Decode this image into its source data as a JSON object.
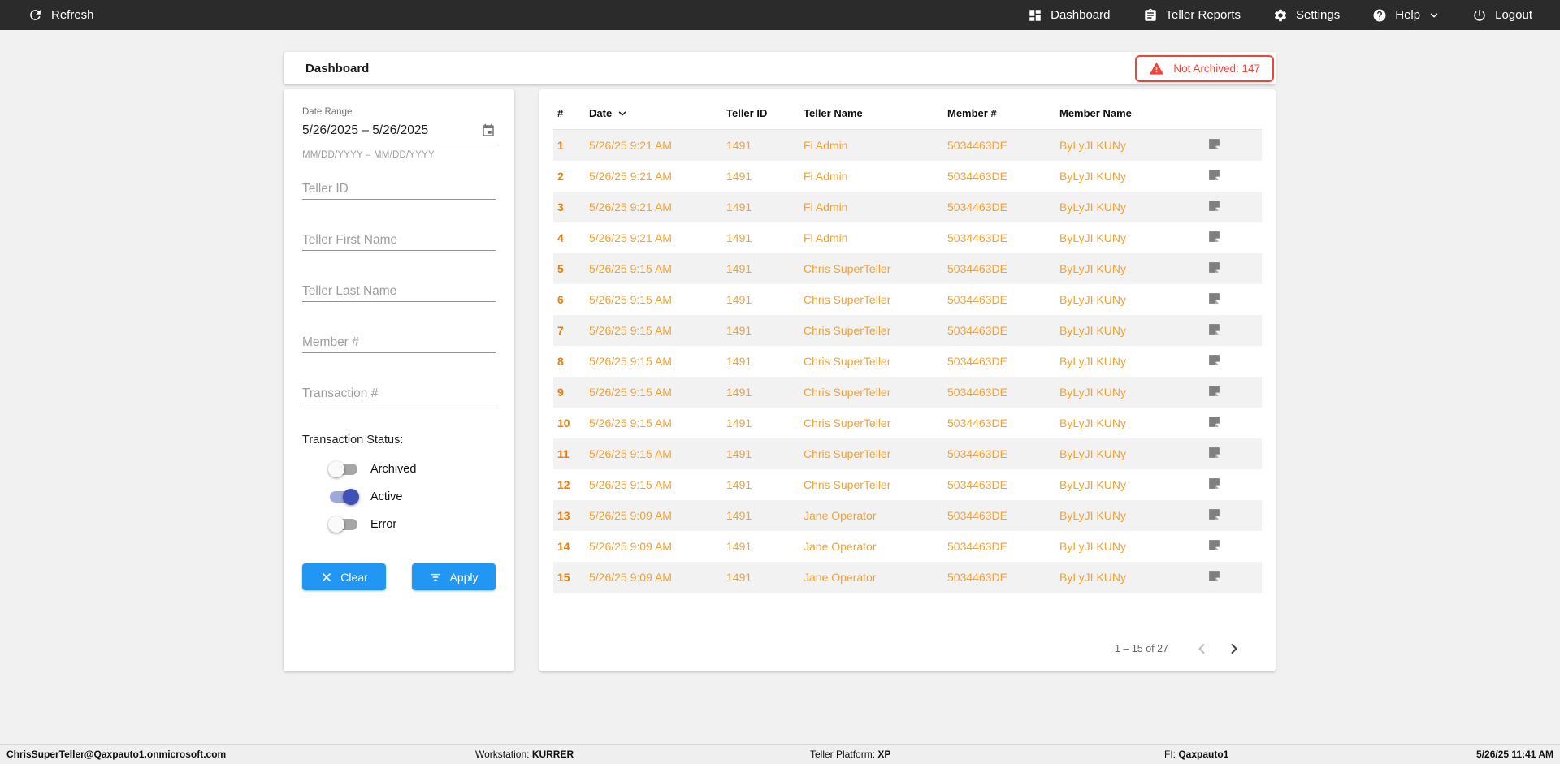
{
  "topnav": {
    "refresh_label": "Refresh",
    "items": [
      {
        "id": "dashboard",
        "label": "Dashboard",
        "icon": "dashboard-icon"
      },
      {
        "id": "teller-reports",
        "label": "Teller Reports",
        "icon": "clipboard-icon"
      },
      {
        "id": "settings",
        "label": "Settings",
        "icon": "gear-icon"
      },
      {
        "id": "help",
        "label": "Help",
        "icon": "help-icon",
        "has_chevron": true
      },
      {
        "id": "logout",
        "label": "Logout",
        "icon": "power-icon"
      }
    ]
  },
  "header": {
    "title": "Dashboard",
    "badge": {
      "label": "Not Archived: 147",
      "icon": "warning-icon",
      "color": "#f44336"
    }
  },
  "filters": {
    "date_range": {
      "label": "Date Range",
      "value": "5/26/2025 – 5/26/2025",
      "hint": "MM/DD/YYYY – MM/DD/YYYY",
      "icon": "calendar-icon"
    },
    "inputs": [
      {
        "id": "teller-id",
        "placeholder": "Teller ID",
        "value": ""
      },
      {
        "id": "teller-first-name",
        "placeholder": "Teller First Name",
        "value": ""
      },
      {
        "id": "teller-last-name",
        "placeholder": "Teller Last Name",
        "value": ""
      },
      {
        "id": "member-number",
        "placeholder": "Member #",
        "value": ""
      },
      {
        "id": "transaction-number",
        "placeholder": "Transaction #",
        "value": ""
      }
    ],
    "status": {
      "label": "Transaction Status:",
      "toggles": [
        {
          "id": "archived",
          "label": "Archived",
          "on": false
        },
        {
          "id": "active",
          "label": "Active",
          "on": true
        },
        {
          "id": "error",
          "label": "Error",
          "on": false
        }
      ]
    },
    "clear_label": "Clear",
    "apply_label": "Apply"
  },
  "table": {
    "columns": [
      {
        "id": "row-number",
        "label": "#"
      },
      {
        "id": "date",
        "label": "Date",
        "sorted": "desc"
      },
      {
        "id": "teller-id",
        "label": "Teller ID"
      },
      {
        "id": "teller-name",
        "label": "Teller Name"
      },
      {
        "id": "member-number",
        "label": "Member #"
      },
      {
        "id": "member-name",
        "label": "Member Name"
      },
      {
        "id": "note",
        "label": ""
      }
    ],
    "rows": [
      {
        "num": "1",
        "date": "5/26/25 9:21 AM",
        "teller_id": "1491",
        "teller_name": "Fi Admin",
        "member_number": "5034463DE",
        "member_name": "ByLyJI KUNy"
      },
      {
        "num": "2",
        "date": "5/26/25 9:21 AM",
        "teller_id": "1491",
        "teller_name": "Fi Admin",
        "member_number": "5034463DE",
        "member_name": "ByLyJI KUNy"
      },
      {
        "num": "3",
        "date": "5/26/25 9:21 AM",
        "teller_id": "1491",
        "teller_name": "Fi Admin",
        "member_number": "5034463DE",
        "member_name": "ByLyJI KUNy"
      },
      {
        "num": "4",
        "date": "5/26/25 9:21 AM",
        "teller_id": "1491",
        "teller_name": "Fi Admin",
        "member_number": "5034463DE",
        "member_name": "ByLyJI KUNy"
      },
      {
        "num": "5",
        "date": "5/26/25 9:15 AM",
        "teller_id": "1491",
        "teller_name": "Chris SuperTeller",
        "member_number": "5034463DE",
        "member_name": "ByLyJI KUNy"
      },
      {
        "num": "6",
        "date": "5/26/25 9:15 AM",
        "teller_id": "1491",
        "teller_name": "Chris SuperTeller",
        "member_number": "5034463DE",
        "member_name": "ByLyJI KUNy"
      },
      {
        "num": "7",
        "date": "5/26/25 9:15 AM",
        "teller_id": "1491",
        "teller_name": "Chris SuperTeller",
        "member_number": "5034463DE",
        "member_name": "ByLyJI KUNy"
      },
      {
        "num": "8",
        "date": "5/26/25 9:15 AM",
        "teller_id": "1491",
        "teller_name": "Chris SuperTeller",
        "member_number": "5034463DE",
        "member_name": "ByLyJI KUNy"
      },
      {
        "num": "9",
        "date": "5/26/25 9:15 AM",
        "teller_id": "1491",
        "teller_name": "Chris SuperTeller",
        "member_number": "5034463DE",
        "member_name": "ByLyJI KUNy"
      },
      {
        "num": "10",
        "date": "5/26/25 9:15 AM",
        "teller_id": "1491",
        "teller_name": "Chris SuperTeller",
        "member_number": "5034463DE",
        "member_name": "ByLyJI KUNy"
      },
      {
        "num": "11",
        "date": "5/26/25 9:15 AM",
        "teller_id": "1491",
        "teller_name": "Chris SuperTeller",
        "member_number": "5034463DE",
        "member_name": "ByLyJI KUNy"
      },
      {
        "num": "12",
        "date": "5/26/25 9:15 AM",
        "teller_id": "1491",
        "teller_name": "Chris SuperTeller",
        "member_number": "5034463DE",
        "member_name": "ByLyJI KUNy"
      },
      {
        "num": "13",
        "date": "5/26/25 9:09 AM",
        "teller_id": "1491",
        "teller_name": "Jane Operator",
        "member_number": "5034463DE",
        "member_name": "ByLyJI KUNy"
      },
      {
        "num": "14",
        "date": "5/26/25 9:09 AM",
        "teller_id": "1491",
        "teller_name": "Jane Operator",
        "member_number": "5034463DE",
        "member_name": "ByLyJI KUNy"
      },
      {
        "num": "15",
        "date": "5/26/25 9:09 AM",
        "teller_id": "1491",
        "teller_name": "Jane Operator",
        "member_number": "5034463DE",
        "member_name": "ByLyJI KUNy"
      }
    ],
    "row_note_icon": "note-icon",
    "pagination": {
      "label": "1 – 15 of 27"
    }
  },
  "statusbar": {
    "user": "ChrisSuperTeller@Qaxpauto1.onmicrosoft.com",
    "workstation_label": "Workstation:",
    "workstation_value": "KURRER",
    "platform_label": "Teller Platform:",
    "platform_value": "XP",
    "fi_label": "FI:",
    "fi_value": "Qaxpauto1",
    "datetime": "5/26/25 11:41 AM"
  },
  "colors": {
    "accent_blue": "#2196f3",
    "alert_red": "#f44336",
    "toggle_active": "#3f51b5",
    "toggle_active_track": "#9fa8da",
    "row_number_orange": "#ef7f00",
    "row_text_orange": "#f6a12f",
    "nav_background": "#2b2b2b",
    "page_background": "#f1f1f1"
  }
}
